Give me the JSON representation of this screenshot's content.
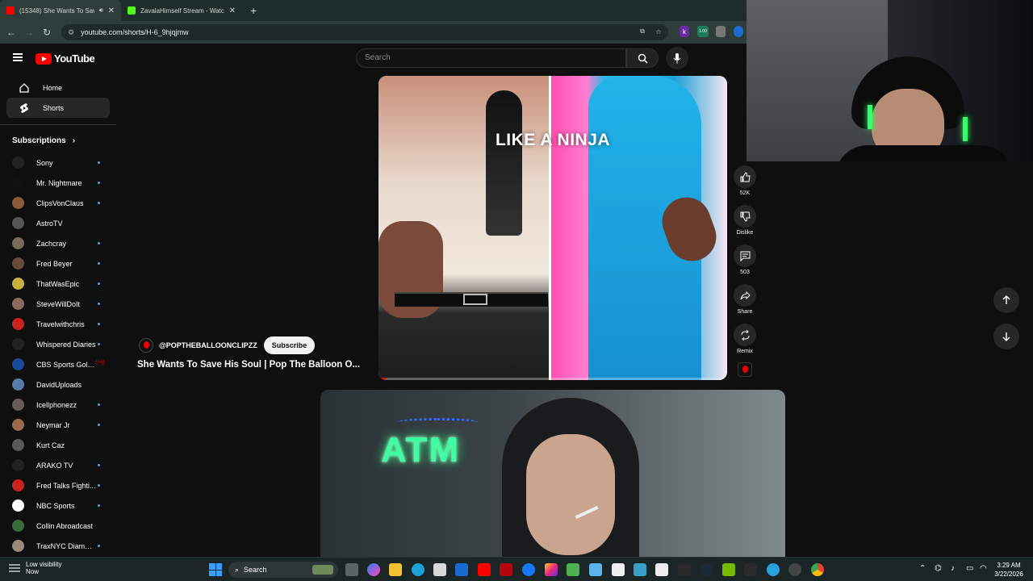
{
  "browser": {
    "tabs": [
      {
        "title": "(15348) She Wants To Save",
        "active": true,
        "favicon_color": "#ff0000"
      },
      {
        "title": "ZavalaHimself Stream - Watch",
        "active": false,
        "favicon_color": "#53fc18"
      }
    ],
    "url": "youtube.com/shorts/H-6_9hjqjmw",
    "extension_k_label": "k",
    "extension_badge": "1.00"
  },
  "youtube": {
    "logo_text": "YouTube",
    "search_placeholder": "Search",
    "nav": [
      {
        "label": "Home",
        "icon": "home-icon"
      },
      {
        "label": "Shorts",
        "icon": "shorts-icon",
        "active": true
      }
    ],
    "subscriptions_title": "Subscriptions",
    "subscriptions": [
      {
        "name": "Sony",
        "color": "#222222",
        "dot": true
      },
      {
        "name": "Mr. Nightmare",
        "color": "#111111",
        "dot": true
      },
      {
        "name": "ClipsVonClaus",
        "color": "#8a5a3a",
        "dot": true
      },
      {
        "name": "AstroTV",
        "color": "#555555",
        "dot": false
      },
      {
        "name": "Zachcray",
        "color": "#7a6a5a",
        "dot": true
      },
      {
        "name": "Fred Beyer",
        "color": "#6a4a3a",
        "dot": true
      },
      {
        "name": "ThatWasEpic",
        "color": "#c8b040",
        "dot": true
      },
      {
        "name": "SteveWillDoIt",
        "color": "#8a6a5a",
        "dot": true
      },
      {
        "name": "Travelwithchris",
        "color": "#cc2222",
        "dot": true
      },
      {
        "name": "Whispered Diaries",
        "color": "#222222",
        "dot": true
      },
      {
        "name": "CBS Sports Gola...",
        "color": "#1a4a9a",
        "dot": false,
        "live": true
      },
      {
        "name": "DavidUploads",
        "color": "#5a7aaa",
        "dot": false
      },
      {
        "name": "Icellphonezz",
        "color": "#6a5a5a",
        "dot": true
      },
      {
        "name": "Neymar Jr",
        "color": "#9a6a4a",
        "dot": true
      },
      {
        "name": "Kurt Caz",
        "color": "#5a5a5a",
        "dot": false
      },
      {
        "name": "ARAKO TV",
        "color": "#222222",
        "dot": true
      },
      {
        "name": "Fred Talks Fighti...",
        "color": "#cc2222",
        "dot": true
      },
      {
        "name": "NBC Sports",
        "color": "#ffffff",
        "dot": true
      },
      {
        "name": "Collin Abroadcast",
        "color": "#3a6a3a",
        "dot": false
      },
      {
        "name": "TraxNYC Diamon...",
        "color": "#9a8a7a",
        "dot": true
      }
    ],
    "short": {
      "caption": "LIKE A NINJA",
      "channel_handle": "@POPTHEBALLOONCLIPZZ",
      "subscribe_label": "Subscribe",
      "title": "She Wants To Save His Soul | Pop The Balloon O...",
      "progress": 0.02,
      "actions": [
        {
          "name": "like",
          "icon": "thumbs-up-icon",
          "label": "52K"
        },
        {
          "name": "dislike",
          "icon": "thumbs-down-icon",
          "label": "Dislike"
        },
        {
          "name": "comments",
          "icon": "comment-icon",
          "label": "503"
        },
        {
          "name": "share",
          "icon": "share-icon",
          "label": "Share"
        },
        {
          "name": "remix",
          "icon": "remix-icon",
          "label": "Remix"
        }
      ]
    },
    "next_short": {
      "sign_text": "ATM"
    }
  },
  "taskbar": {
    "weather_line1": "Low visibility",
    "weather_line2": "Now",
    "search_label": "Search",
    "time": "3:29 AM",
    "date": "3/22/2026"
  }
}
